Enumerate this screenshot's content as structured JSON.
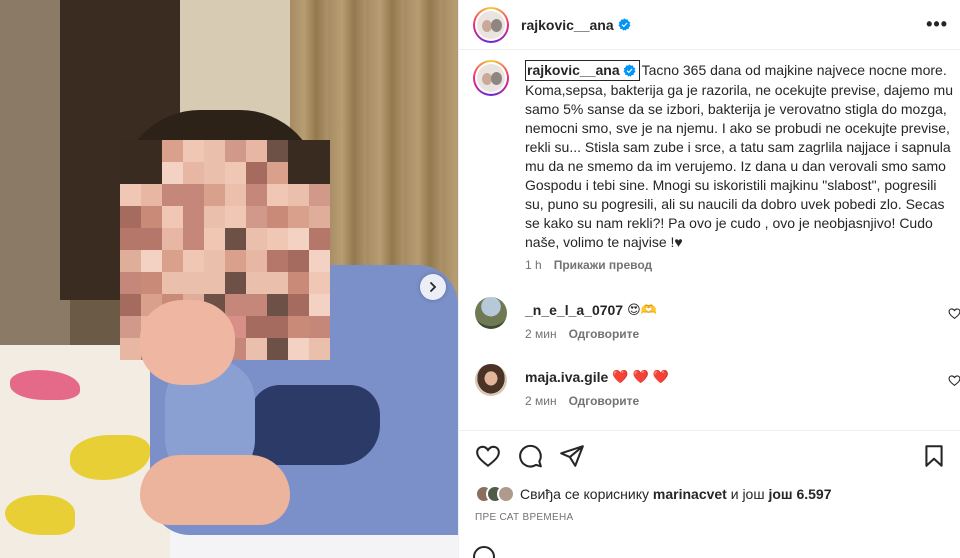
{
  "post": {
    "username": "rajkovic__ana",
    "more_label": "•••",
    "caption": "Tacno 365 dana od majkine najvece nocne more. Koma,sepsa, bakterija ga je razorila, ne ocekujte previse, dajemo mu samo 5% sanse da se izbori, bakterija je verovatno stigla do mozga, nemocni smo, sve je na njemu. I ako se probudi ne ocekujte previse, rekli su... Stisla sam zube i srce, a tatu sam zagrlila najjace i sapnula mu da ne smemo da im verujemo. Iz dana u dan verovali smo samo Gospodu i tebi sine. Mnogi su iskoristili majkinu \"slabost\", pogresili su, puno su pogresili, ali su naucili da dobro uvek pobedi zlo. Secas se kako su nam rekli?! Pa ovo je cudo , ovo je neobjasnjivo! Cudo naše, volimo te najvise !♥",
    "caption_time": "1 h",
    "translate_label": "Прикажи превод"
  },
  "comments": [
    {
      "username": "_n_e_l_a_0707",
      "text": "😍🫶",
      "time": "2 мин",
      "reply": "Одговорите"
    },
    {
      "username": "maja.iva.gile",
      "text": "❤️ ❤️ ❤️",
      "time": "2 мин",
      "reply": "Одговорите"
    }
  ],
  "likes": {
    "prefix": "Свиђа се кориснику",
    "user": "marinacvet",
    "middle": "и још",
    "count_label": "још 6.597"
  },
  "timestamp": "ПРЕ САТ ВРЕМЕНА",
  "icons": {
    "verified": "verified-badge-icon",
    "next": "chevron-right-icon",
    "like": "heart-icon",
    "comment": "comment-icon",
    "share": "send-icon",
    "save": "bookmark-icon",
    "emoji": "emoji-icon"
  },
  "colors": {
    "verified": "#0095f6",
    "text": "#262626",
    "secondary": "#737373",
    "heart": "#ed1c3b"
  }
}
